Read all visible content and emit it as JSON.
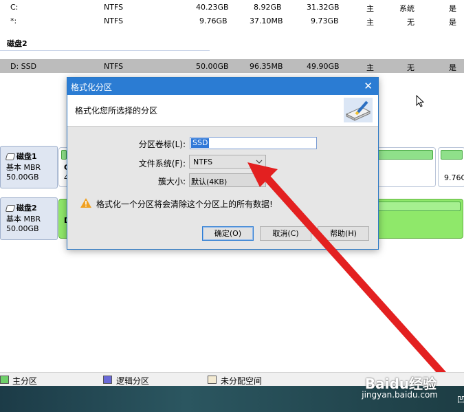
{
  "partition_rows": [
    {
      "name": "C:",
      "fs": "NTFS",
      "capacity": "40.23GB",
      "used": "8.92GB",
      "free": "31.32GB",
      "type": "主",
      "status": "系统",
      "active": "是"
    },
    {
      "name": "*:",
      "fs": "NTFS",
      "capacity": "9.76GB",
      "used": "37.10MB",
      "free": "9.73GB",
      "type": "主",
      "status": "无",
      "active": "是"
    }
  ],
  "disk2_header": "磁盘2",
  "disk2_row": {
    "name": "D: SSD",
    "fs": "NTFS",
    "capacity": "50.00GB",
    "used": "96.35MB",
    "free": "49.90GB",
    "type": "主",
    "status": "无",
    "active": "是"
  },
  "disk_map": [
    {
      "name": "磁盘1",
      "type": "基本 MBR",
      "size": "50.00GB",
      "partition_letter": "C",
      "partition_fragment": "4",
      "last_partition_size": "9.76G"
    },
    {
      "name": "磁盘2",
      "type": "基本 MBR",
      "size": "50.00GB",
      "partition_letter": "D"
    }
  ],
  "dialog": {
    "title": "格式化分区",
    "close_glyph": "✕",
    "header": "格式化您所选择的分区",
    "label_volume": "分区卷标(L):",
    "volume_value": "SSD",
    "label_fs": "文件系统(F):",
    "fs_value": "NTFS",
    "label_cluster": "簇大小:",
    "cluster_value": "默认(4KB)",
    "warning": "格式化一个分区将会清除这个分区上的所有数据!",
    "btn_ok": "确定(O)",
    "btn_cancel": "取消(C)",
    "btn_help": "帮助(H)"
  },
  "legend": [
    {
      "label": "主分区",
      "color": "#6fd06a"
    },
    {
      "label": "逻辑分区",
      "color": "#6a6ad8"
    },
    {
      "label": "未分配空间",
      "color": "#f3ead2"
    }
  ],
  "watermark": "Baidu经验",
  "watermark_url": "jingyan.baidu.com",
  "taskbar_glyph": "凹",
  "colors": {
    "accent": "#2b7cd3",
    "arrow": "#e32020",
    "selected_row": "#bcbcbc"
  }
}
